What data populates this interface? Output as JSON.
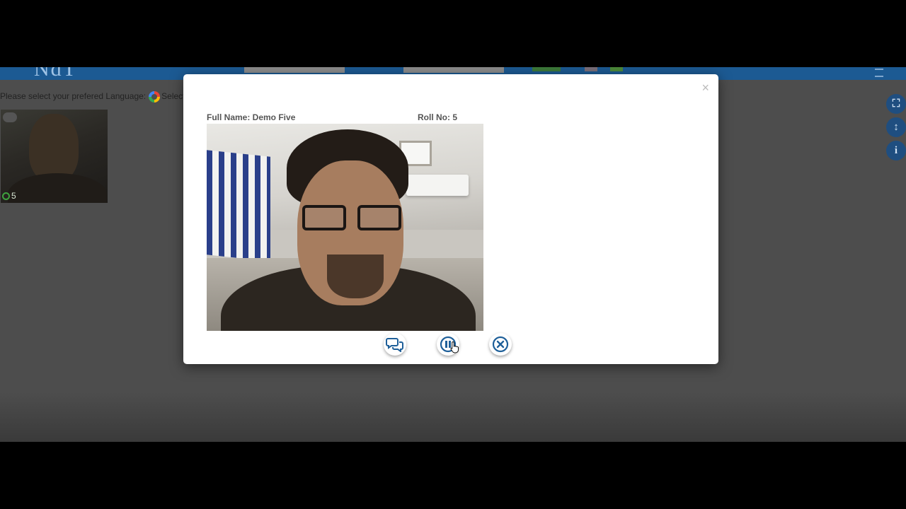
{
  "header": {
    "logo_text": "NdT",
    "menu_icon": "hamburger-menu-icon"
  },
  "language_bar": {
    "label": "Please select your prefered Language:",
    "select_label": "Select"
  },
  "participant_thumbnail": {
    "roll_no": "5",
    "status_color": "#3fa33f"
  },
  "side_tools": [
    {
      "icon": "fullscreen-icon",
      "glyph": "⛶"
    },
    {
      "icon": "resize-vertical-icon",
      "glyph": "↕"
    },
    {
      "icon": "info-icon",
      "glyph": "i"
    }
  ],
  "modal": {
    "close_glyph": "×",
    "full_name_label": "Full Name: Demo Five",
    "roll_no_label": "Roll No: 5",
    "controls": [
      {
        "name": "chat-button",
        "icon": "chat-bubbles-icon"
      },
      {
        "name": "pause-button",
        "icon": "pause-icon"
      },
      {
        "name": "end-button",
        "icon": "close-circle-icon"
      }
    ]
  },
  "colors": {
    "accent": "#1c5a93",
    "icon_blue": "#1e5f99",
    "overlay_gray": "#4d4d4d"
  }
}
